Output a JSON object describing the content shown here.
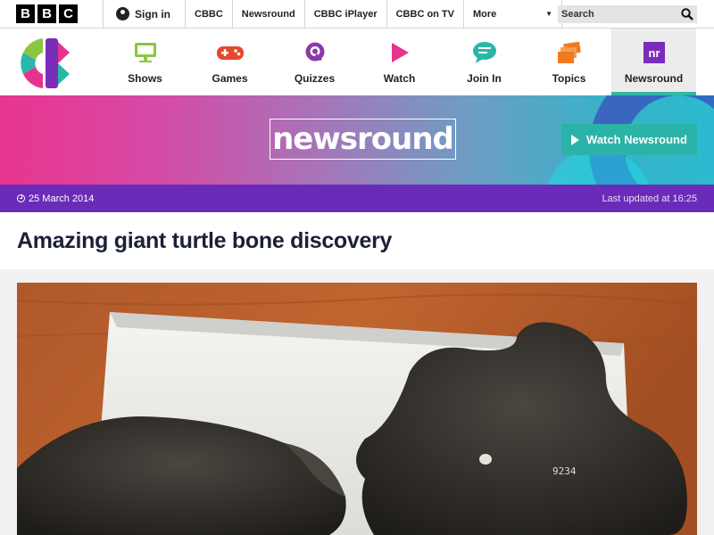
{
  "bbc_bar": {
    "logo_letters": [
      "B",
      "B",
      "C"
    ],
    "signin_label": "Sign in",
    "links": [
      "CBBC",
      "Newsround",
      "CBBC iPlayer",
      "CBBC on TV"
    ],
    "more_label": "More",
    "search_placeholder": "Search"
  },
  "cbbc_nav": {
    "items": [
      {
        "label": "Shows",
        "icon": "tv-icon",
        "color": "#8cc63f"
      },
      {
        "label": "Games",
        "icon": "gamepad-icon",
        "color": "#e5482d"
      },
      {
        "label": "Quizzes",
        "icon": "quiz-icon",
        "color": "#8b3aa6"
      },
      {
        "label": "Watch",
        "icon": "play-icon",
        "color": "#e6338f"
      },
      {
        "label": "Join In",
        "icon": "chat-icon",
        "color": "#29b7a8"
      },
      {
        "label": "Topics",
        "icon": "stack-icon",
        "color": "#f07a20"
      },
      {
        "label": "Newsround",
        "icon": "newsround-icon",
        "color": "#7a2db8",
        "active": true
      }
    ]
  },
  "banner": {
    "logo_text": "newsround",
    "watch_button": "Watch Newsround"
  },
  "article": {
    "date": "25 March 2014",
    "updated": "Last updated at 16:25",
    "title": "Amazing giant turtle bone discovery"
  },
  "colors": {
    "accent_purple": "#6a2cb8",
    "teal": "#2bb3a8"
  }
}
